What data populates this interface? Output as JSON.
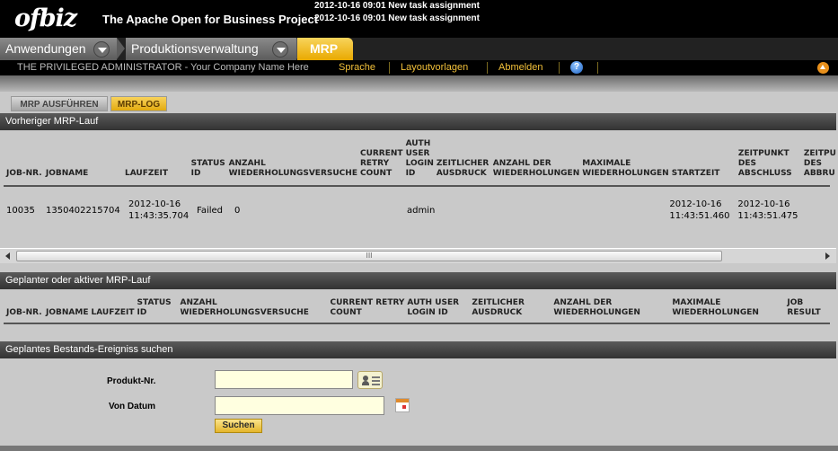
{
  "header": {
    "logo": "ofbiz",
    "project": "The Apache Open for Business Project",
    "notifications": [
      "2012-10-16 09:01 New task assignment",
      "2012-10-16 09:01 New task assignment"
    ]
  },
  "apptabs": {
    "applications": "Anwendungen",
    "manufacturing": "Produktionsverwaltung",
    "mrp": "MRP"
  },
  "userbar": {
    "user": "THE PRIVILEGED ADMINISTRATOR - Your Company Name Here",
    "language": "Sprache",
    "layouts": "Layoutvorlagen",
    "logout": "Abmelden",
    "help_icon": "help-icon",
    "up_icon": "arrow-up-icon"
  },
  "pagetabs": {
    "run": "MRP AUSFÜHREN",
    "log": "MRP-LOG"
  },
  "prev_run": {
    "title": "Vorheriger MRP-Lauf",
    "headers": [
      [
        "JOB-NR."
      ],
      [
        "JOBNAME"
      ],
      [
        "LAUFZEIT"
      ],
      [
        "STATUS",
        "ID"
      ],
      [
        "ANZAHL",
        "WIEDERHOLUNGSVERSUCHE"
      ],
      [
        "CURRENT",
        "RETRY",
        "COUNT"
      ],
      [
        "AUTH",
        "USER",
        "LOGIN",
        "ID"
      ],
      [
        "ZEITLICHER",
        "AUSDRUCK"
      ],
      [
        "ANZAHL DER",
        "WIEDERHOLUNGEN"
      ],
      [
        "MAXIMALE",
        "WIEDERHOLUNGEN"
      ],
      [
        "STARTZEIT"
      ],
      [
        "ZEITPUNKT",
        "DES",
        "ABSCHLUSS"
      ],
      [
        "ZEITPU",
        "DES",
        "ABBRU"
      ]
    ],
    "row": {
      "job_nr": "10035",
      "jobname": "1350402215704",
      "laufzeit": [
        "2012-10-16",
        "11:43:35.704"
      ],
      "status": "Failed",
      "attempts": "0",
      "auth_user": "admin",
      "start": [
        "2012-10-16",
        "11:43:51.460"
      ],
      "finished": [
        "2012-10-16",
        "11:43:51.475"
      ]
    },
    "scroll_grip": "III"
  },
  "planned_run": {
    "title": "Geplanter oder aktiver MRP-Lauf",
    "headers": [
      [
        "JOB-NR."
      ],
      [
        "JOBNAME"
      ],
      [
        "LAUFZEIT"
      ],
      [
        "STATUS",
        "ID"
      ],
      [
        "ANZAHL",
        "WIEDERHOLUNGSVERSUCHE"
      ],
      [
        "CURRENT RETRY",
        "COUNT"
      ],
      [
        "AUTH USER",
        "LOGIN ID"
      ],
      [
        "ZEITLICHER",
        "AUSDRUCK"
      ],
      [
        "ANZAHL DER",
        "WIEDERHOLUNGEN"
      ],
      [
        "MAXIMALE",
        "WIEDERHOLUNGEN"
      ],
      [
        "JOB",
        "RESULT"
      ]
    ]
  },
  "search": {
    "title": "Geplantes Bestands-Ereigniss suchen",
    "product_label": "Produkt-Nr.",
    "product_value": "",
    "from_label": "Von Datum",
    "from_value": "",
    "submit": "Suchen",
    "lookup_icon": "lookup-icon",
    "calendar_icon": "calendar-icon"
  }
}
